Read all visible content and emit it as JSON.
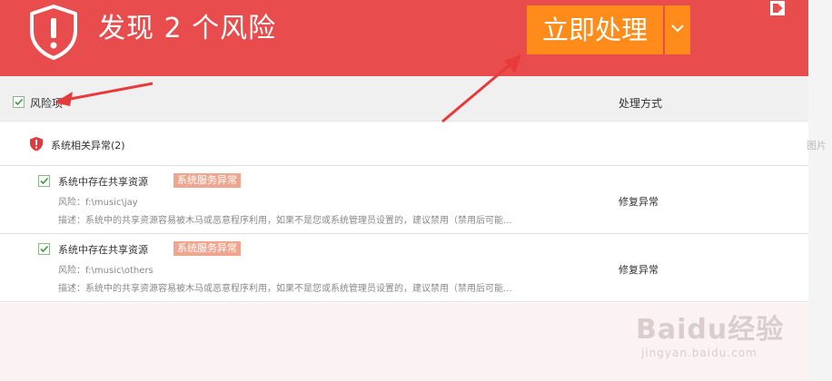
{
  "header": {
    "title": "发现 2 个风险",
    "fix_button": "立即处理",
    "bg_color": "#e84c4c",
    "button_color": "#ff8c1a"
  },
  "icons": {
    "shield": "shield-alert-icon",
    "dropdown": "chevron-down-icon",
    "exit": "exit-icon"
  },
  "table_header": {
    "risk_label": "风险项",
    "action_label": "处理方式"
  },
  "group": {
    "label": "系统相关异常(2)"
  },
  "items": [
    {
      "title": "系统中存在共享资源",
      "badge": "系统服务异常",
      "risk": "风险：f:\\music\\jay",
      "description": "描述：系统中的共享资源容易被木马或恶意程序利用，如果不是您或系统管理员设置的，建议禁用（禁用后可能...",
      "action": "修复异常"
    },
    {
      "title": "系统中存在共享资源",
      "badge": "系统服务异常",
      "risk": "风险：f:\\music\\others",
      "description": "描述：系统中的共享资源容易被木马或恶意程序利用，如果不是您或系统管理员设置的，建议禁用（禁用后可能...",
      "action": "修复异常"
    }
  ],
  "gutter": {
    "text": "图片"
  },
  "watermark": {
    "logo": "Baidu经验",
    "url": "jingyan.baidu.com"
  }
}
